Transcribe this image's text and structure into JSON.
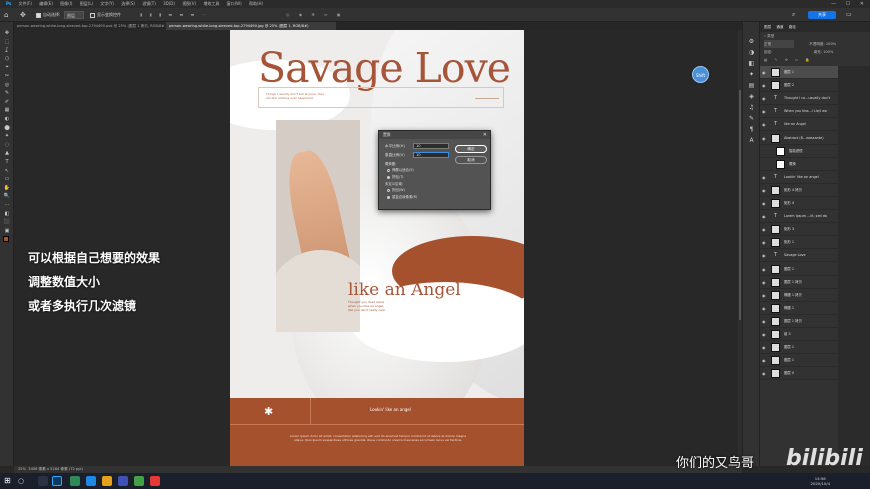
{
  "menubar": {
    "items": [
      "文件(F)",
      "编辑(E)",
      "图像(I)",
      "图层(L)",
      "文字(Y)",
      "选择(S)",
      "滤镜(T)",
      "3D(D)",
      "视图(V)",
      "增效工具",
      "窗口(W)",
      "帮助(H)"
    ],
    "window_controls": "— ☐ ✕"
  },
  "options": {
    "home": "⌂",
    "move": "✥",
    "auto_select": "自动选择:",
    "layer_select": "图层",
    "show_transform": "显示变换控件",
    "cloud_label": "共享"
  },
  "tabs": [
    {
      "label": "person-wearing-white-long-sleeved-top-2794490.psd @ 25% (图层 1 拷贝, RGB/8#)"
    },
    {
      "label": "person-wearing-white-long-sleeved-top-2794490.jpg @ 25% (图层 1, RGB/8#)"
    }
  ],
  "tools": [
    "✥",
    "⬚",
    "ʆ",
    "⬡",
    "⌖",
    "✂",
    "◎",
    "✎",
    "✐",
    "▦",
    "◐",
    "⬤",
    "✦",
    "◌",
    "▲",
    "T",
    "↖",
    "▭",
    "✋",
    "🔍",
    "⋯",
    "◧",
    "⬛",
    "▣"
  ],
  "document": {
    "headline": "Savage Love",
    "tagline": "Things I usually don't tell anyone, they act like nothing ever happened",
    "subtitle": "like an Angel",
    "subtitle_body": "Thought you lived alone when you kiss an angel, like you don't really care",
    "star": "✱",
    "looking": "Lookin' like an angel",
    "footer": "Lorem ipsum dolor sit amet, consectetur adipiscing elit, sed do eiusmod tempor incididunt ut labore et dolore magna aliqua. Quis ipsum suspendisse ultrices gravida. Risus commodo viverra maecenas accumsan lacus vel facilisis."
  },
  "dialog": {
    "title": "置换",
    "close": "✕",
    "h_label": "水平比例(H)",
    "h_value": "10",
    "v_label": "垂直比例(V)",
    "v_value": "10",
    "ok": "确定",
    "cancel": "取消",
    "map_group": "置换图:",
    "stretch": "伸展以适合(S)",
    "tile": "拼贴(T)",
    "undefined_group": "未定义区域:",
    "wrap": "折回(W)",
    "repeat": "重复边缘像素(R)"
  },
  "cursor_badge": "Shift",
  "caption": {
    "line1": "可以根据自己想要的效果",
    "line2": "调整数值大小",
    "line3": "或者多执行几次滤镜"
  },
  "right_icons": [
    "⚙",
    "◑",
    "◧",
    "✦",
    "▤",
    "◈",
    "♫",
    "✎",
    "¶",
    "A"
  ],
  "panel": {
    "tabs": [
      "图层",
      "通道",
      "路径"
    ],
    "filter": "类型",
    "blend": "正常",
    "opacity": "不透明度: 100%",
    "fill": "填充: 100%",
    "lock": "锁定:",
    "layers": [
      {
        "name": "图层 1",
        "kind": "img",
        "selected": true
      },
      {
        "name": "图层 2",
        "kind": "img"
      },
      {
        "name": "Thought I co...usually don't",
        "kind": "text"
      },
      {
        "name": "When you kiss...I Lie/I wa",
        "kind": "text"
      },
      {
        "name": "like an Angel",
        "kind": "text"
      },
      {
        "name": "Abstract (B...wassante)",
        "kind": "img"
      },
      {
        "name": "智能滤镜",
        "kind": "sub"
      },
      {
        "name": "置换",
        "kind": "sub"
      },
      {
        "name": "Lookin' like an angel",
        "kind": "text"
      },
      {
        "name": "矩形 4 拷贝",
        "kind": "img"
      },
      {
        "name": "矩形 4",
        "kind": "img"
      },
      {
        "name": "Lorem ipsum ...lit, sed do",
        "kind": "text"
      },
      {
        "name": "矩形 3",
        "kind": "img"
      },
      {
        "name": "矩形 1",
        "kind": "img"
      },
      {
        "name": "Savage Love",
        "kind": "text"
      },
      {
        "name": "图层 1",
        "kind": "img"
      },
      {
        "name": "图层 1 拷贝",
        "kind": "img"
      },
      {
        "name": "椭圆 1 拷贝",
        "kind": "img"
      },
      {
        "name": "椭圆 1",
        "kind": "img"
      },
      {
        "name": "图层 1 拷贝",
        "kind": "img"
      },
      {
        "name": "组 5",
        "kind": "img"
      },
      {
        "name": "图层 1",
        "kind": "img"
      },
      {
        "name": "图层 1",
        "kind": "img"
      },
      {
        "name": "图层 0",
        "kind": "img"
      }
    ]
  },
  "status": {
    "zoom": "25%",
    "doc": "3456 像素 x 5184 像素 (72 ppi)"
  },
  "clock": {
    "time": "14:56",
    "date": "2020/10/4"
  },
  "watermark": {
    "text": "你们的又鸟哥",
    "brand": "bilibili"
  }
}
